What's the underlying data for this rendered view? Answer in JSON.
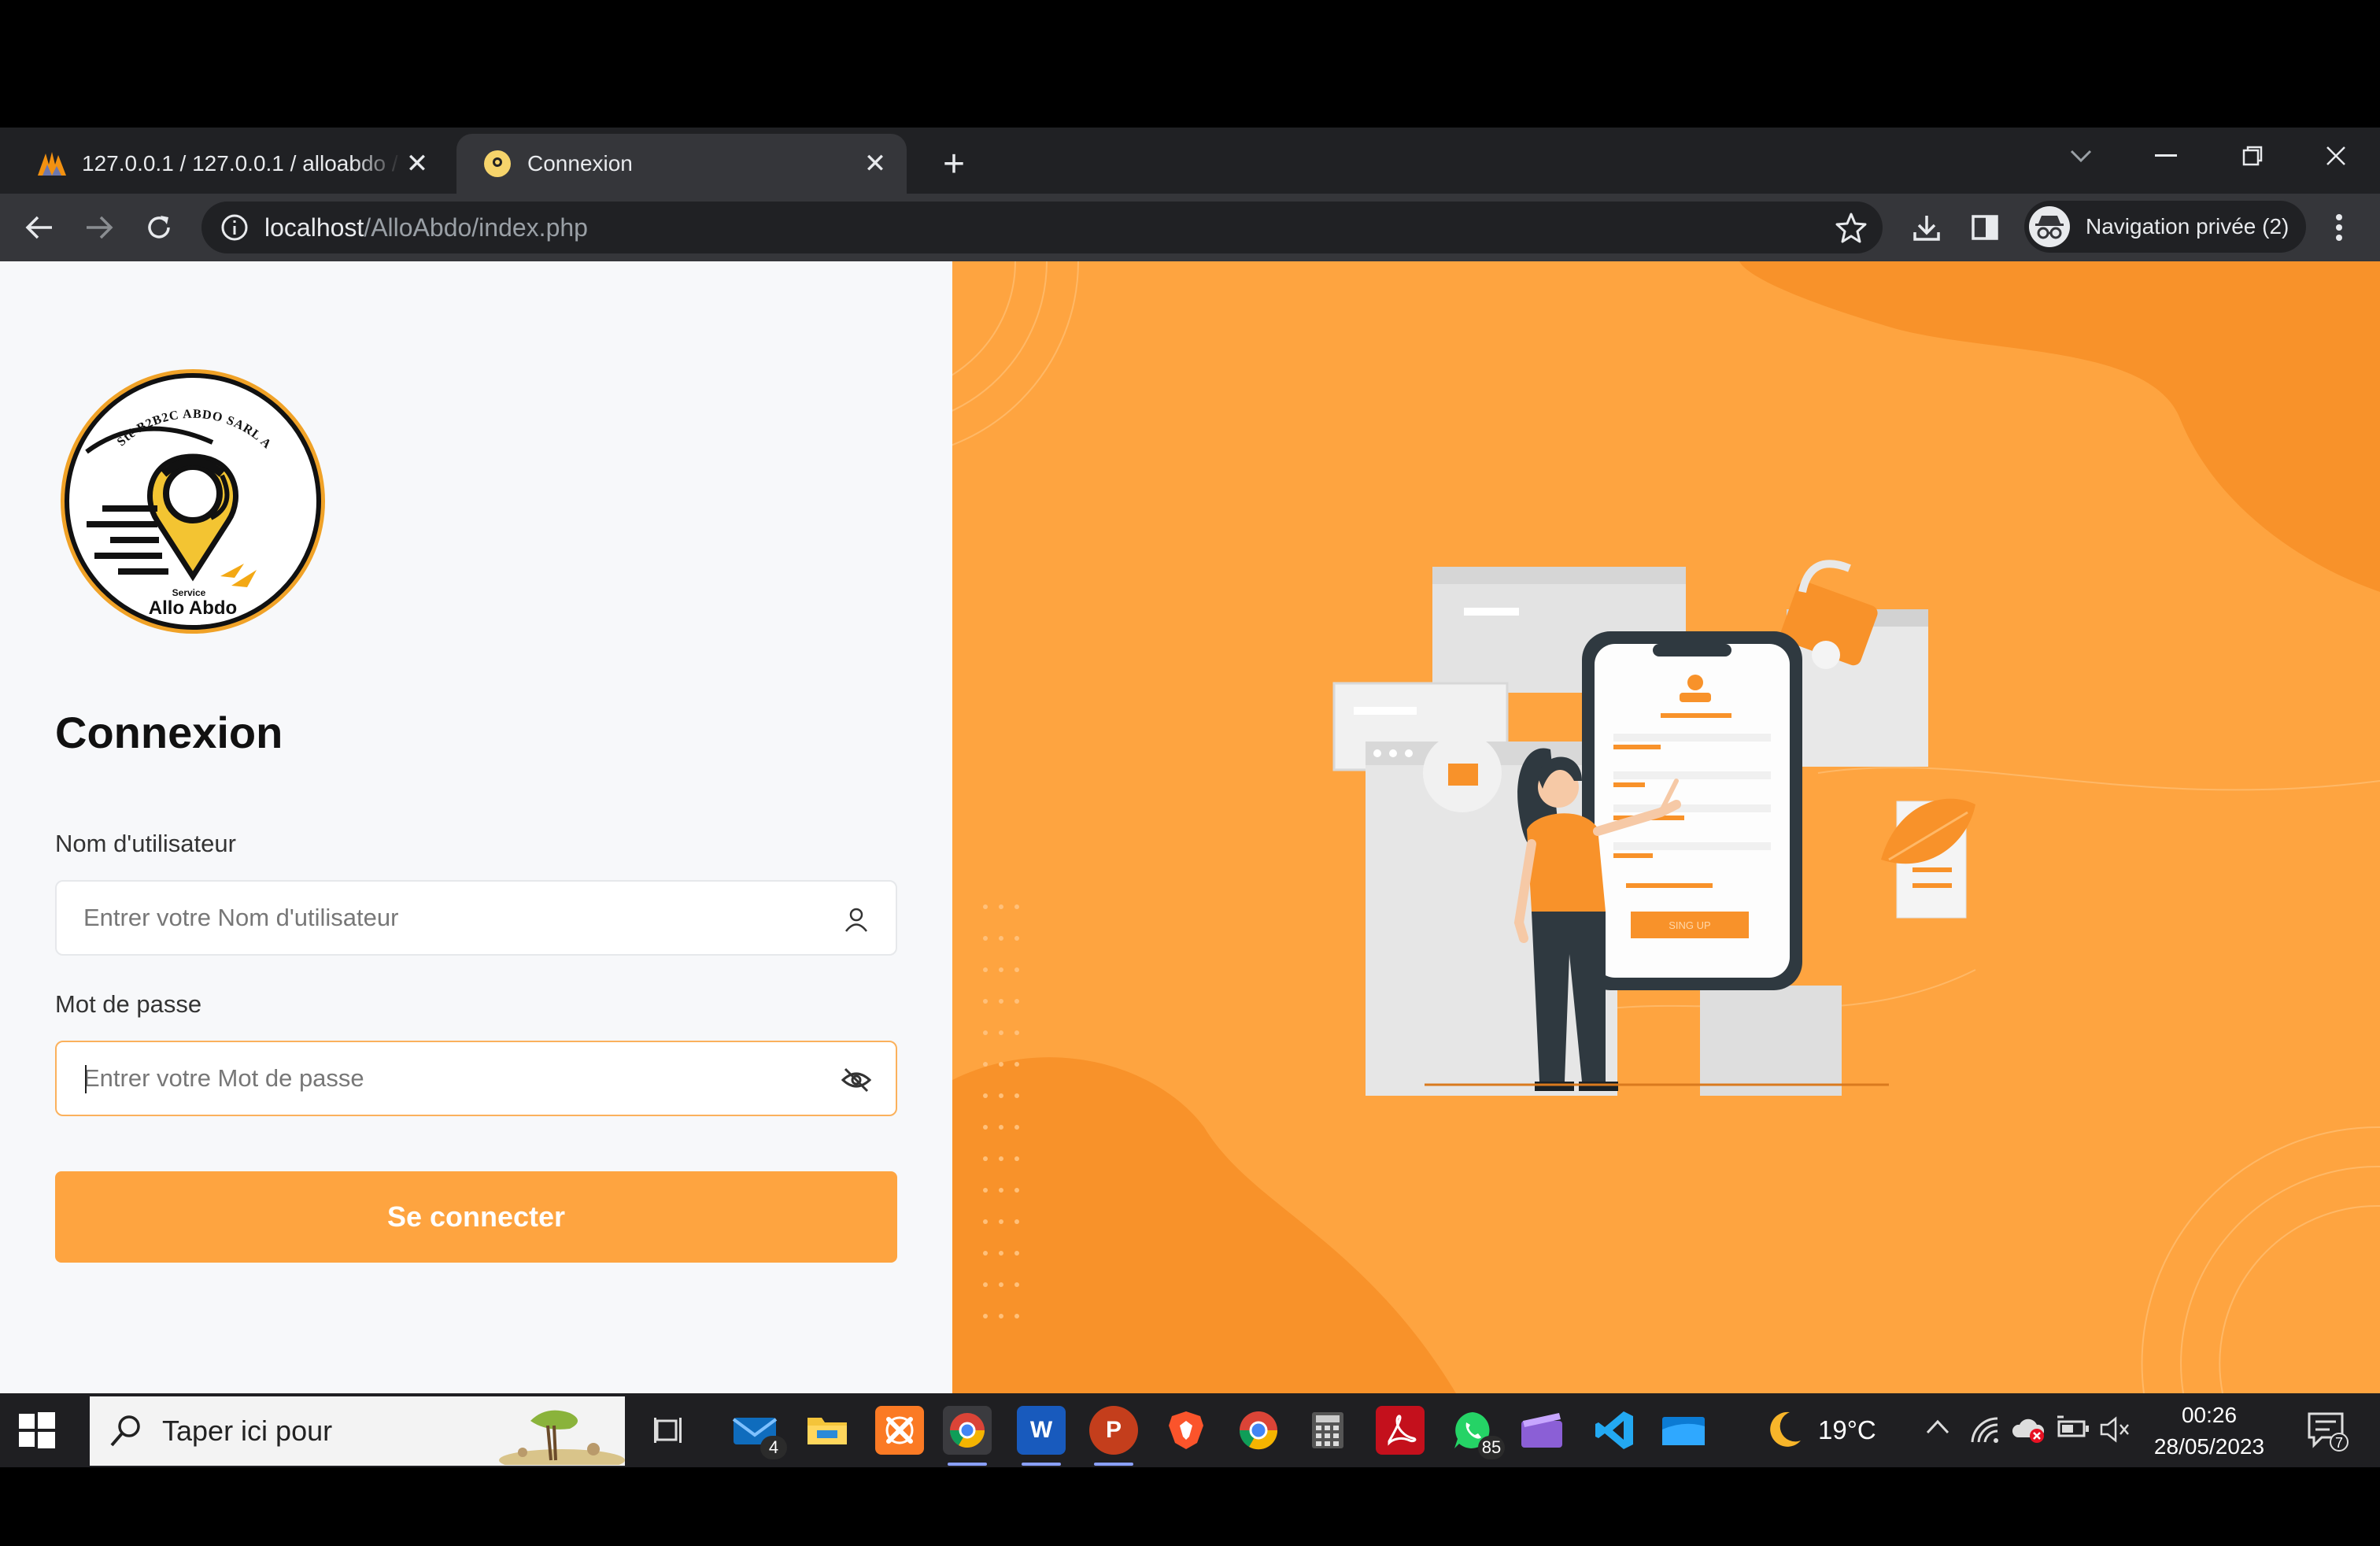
{
  "browser": {
    "tabs": [
      {
        "title": "127.0.0.1 / 127.0.0.1 / alloabdo / ",
        "close": "✕"
      },
      {
        "title": "Connexion",
        "close": "✕"
      }
    ],
    "new_tab": "+",
    "address": {
      "host": "localhost",
      "path": "/AlloAbdo/index.php"
    },
    "profile_label": "Navigation privée (2)"
  },
  "login": {
    "logo": {
      "arc_text": "Sté B2B2C ABDO SARL AU",
      "small_text": "Service",
      "brand": "Allo Abdo"
    },
    "title": "Connexion",
    "username": {
      "label": "Nom d'utilisateur",
      "placeholder": "Entrer votre Nom d'utilisateur"
    },
    "password": {
      "label": "Mot de passe",
      "placeholder": "Entrer votre Mot de passe"
    },
    "submit_label": "Se connecter"
  },
  "illustration": {
    "button_text": "SING UP"
  },
  "taskbar": {
    "search_text": "Taper ici pour",
    "mail_badge": "4",
    "whatsapp_badge": "85",
    "temperature": "19°C",
    "time": "00:26",
    "date": "28/05/2023",
    "notification_count": "7"
  },
  "colors": {
    "accent": "#fea440",
    "page_bg": "#f7f8fa",
    "chrome_dark": "#202124",
    "chrome_toolbar": "#35363a",
    "taskbar": "#1f1f22"
  }
}
